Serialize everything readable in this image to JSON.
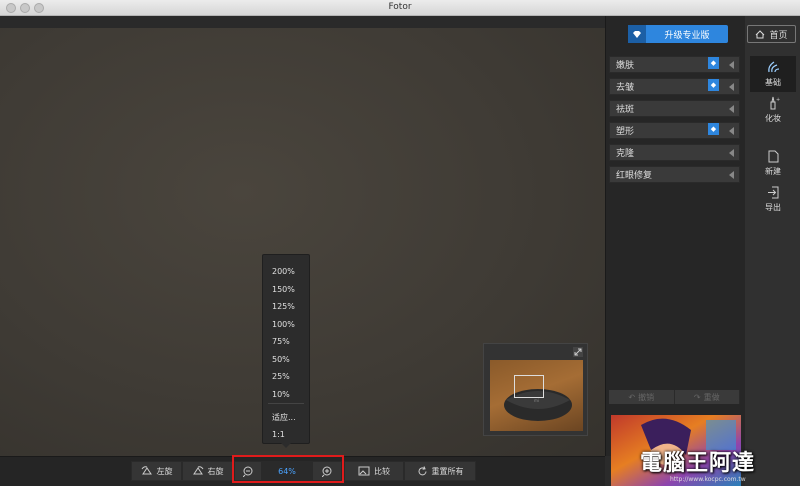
{
  "window": {
    "title": "Fotor"
  },
  "header": {
    "upgrade_label": "升级专业版",
    "home_label": "首页"
  },
  "tools": [
    {
      "label": "嫩肤",
      "premium": true
    },
    {
      "label": "去皱",
      "premium": true
    },
    {
      "label": "祛斑",
      "premium": false
    },
    {
      "label": "塑形",
      "premium": true
    },
    {
      "label": "克隆",
      "premium": false
    },
    {
      "label": "红眼修复",
      "premium": false
    }
  ],
  "rail": [
    {
      "label": "基础",
      "icon": "hand-wave-icon",
      "active": true
    },
    {
      "label": "化妆",
      "icon": "makeup-brush-icon",
      "active": false
    },
    {
      "label": "新建",
      "icon": "new-file-icon",
      "active": false
    },
    {
      "label": "导出",
      "icon": "export-icon",
      "active": false
    }
  ],
  "history": {
    "undo_label": "撤销",
    "redo_label": "重做"
  },
  "zoom_menu": {
    "options": [
      "200%",
      "150%",
      "125%",
      "100%",
      "75%",
      "50%",
      "25%",
      "10%"
    ],
    "fit_label": "适应...",
    "actual_label": "1:1"
  },
  "toolbar": {
    "rotate_left_label": "左旋",
    "rotate_right_label": "右旋",
    "zoom_value": "64%",
    "compare_label": "比较",
    "reset_label": "重置所有"
  },
  "watermark": {
    "text": "電腦王阿達",
    "url": "http://www.kocpc.com.tw"
  },
  "colors": {
    "accent": "#2e86de",
    "zoom_text": "#4aa3ff",
    "highlight": "#e01b1b"
  }
}
